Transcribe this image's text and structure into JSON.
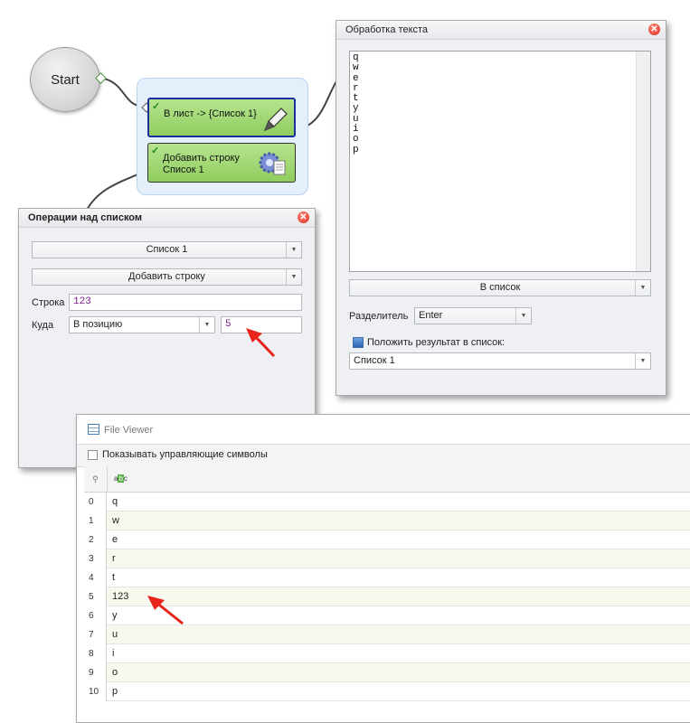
{
  "canvas": {
    "start_label": "Start",
    "block1_label": "В лист -> {Список 1}",
    "block2_label": "Добавить строку Список 1"
  },
  "list_ops": {
    "title": "Операции над списком",
    "list_select": "Список 1",
    "operation_select": "Добавить строку",
    "string_label": "Строка",
    "string_value": "123",
    "where_label": "Куда",
    "where_select": "В позицию",
    "position_value": "5"
  },
  "text_proc": {
    "title": "Обработка текста",
    "text_lines": [
      "q",
      "w",
      "e",
      "r",
      "t",
      "y",
      "u",
      "i",
      "o",
      "p"
    ],
    "mode_select": "В список",
    "separator_label": "Разделитель",
    "separator_value": "Enter",
    "put_result_label": "Положить результат в список:",
    "result_list_select": "Список 1"
  },
  "file_viewer": {
    "title": "File Viewer",
    "show_control_chars_label": "Показывать управляющие символы",
    "column_header_icon": "abc-type-icon",
    "rows": [
      {
        "index": "0",
        "value": "q"
      },
      {
        "index": "1",
        "value": "w"
      },
      {
        "index": "2",
        "value": "e"
      },
      {
        "index": "3",
        "value": "r"
      },
      {
        "index": "4",
        "value": "t"
      },
      {
        "index": "5",
        "value": "123"
      },
      {
        "index": "6",
        "value": "y"
      },
      {
        "index": "7",
        "value": "u"
      },
      {
        "index": "8",
        "value": "i"
      },
      {
        "index": "9",
        "value": "o"
      },
      {
        "index": "10",
        "value": "p"
      }
    ]
  },
  "colors": {
    "row_even": "#ffffff",
    "row_odd": "#f8f8ee",
    "annotation_arrow": "#e8231a"
  }
}
